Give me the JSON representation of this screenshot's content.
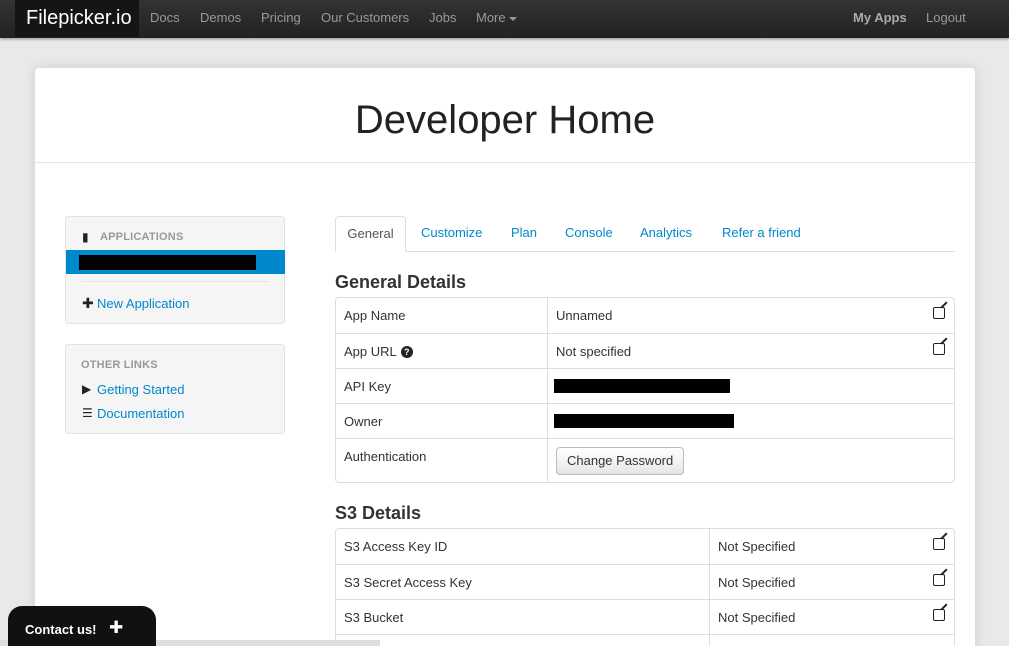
{
  "navbar": {
    "brand": "Filepicker.io",
    "links": [
      "Docs",
      "Demos",
      "Pricing",
      "Our Customers",
      "Jobs",
      "More"
    ],
    "my_apps": "My Apps",
    "logout": "Logout"
  },
  "page": {
    "title": "Developer Home"
  },
  "sidebar": {
    "applications_header": "APPLICATIONS",
    "new_application": "New Application",
    "other_links_header": "OTHER LINKS",
    "getting_started": "Getting Started",
    "documentation": "Documentation"
  },
  "tabs": [
    "General",
    "Customize",
    "Plan",
    "Console",
    "Analytics",
    "Refer a friend"
  ],
  "general_details": {
    "heading": "General Details",
    "rows": [
      {
        "label": "App Name",
        "value": "Unnamed"
      },
      {
        "label": "App URL",
        "value": "Not specified"
      },
      {
        "label": "API Key",
        "value": ""
      },
      {
        "label": "Owner",
        "value": ""
      },
      {
        "label": "Authentication",
        "button": "Change Password"
      }
    ]
  },
  "s3_details": {
    "heading": "S3 Details",
    "rows": [
      {
        "label": "S3 Access Key ID",
        "value": "Not Specified"
      },
      {
        "label": "S3 Secret Access Key",
        "value": "Not Specified"
      },
      {
        "label": "S3 Bucket",
        "value": "Not Specified"
      }
    ]
  },
  "contact": {
    "label": "Contact us!"
  },
  "colors": {
    "accent": "#0088cc",
    "navbar": "#222222",
    "background": "#e9e9e9"
  },
  "icons": [
    "book-icon",
    "plus-icon",
    "play-circle-icon",
    "list-icon",
    "question-icon",
    "edit-icon"
  ]
}
